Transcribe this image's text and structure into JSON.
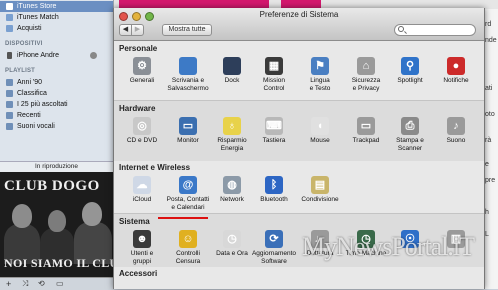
{
  "itunes": {
    "sidebar": {
      "store_items": [
        {
          "label": "iTunes Store",
          "icon": "store-icon",
          "color": "#5b7fb5",
          "selected": true
        },
        {
          "label": "iTunes Match",
          "icon": "cloud-icon",
          "color": "#7aa0d0"
        },
        {
          "label": "Acquisti",
          "icon": "download-icon",
          "color": "#7aa0d0"
        }
      ],
      "devices_heading": "DISPOSITIVI",
      "device_items": [
        {
          "label": "iPhone Andre",
          "icon": "iphone-icon",
          "color": "#555555"
        }
      ],
      "playlist_heading": "PLAYLIST",
      "playlist_items": [
        {
          "label": "Anni '90",
          "icon": "gear-playlist-icon",
          "color": "#6f8fb8"
        },
        {
          "label": "Classifica",
          "icon": "gear-playlist-icon",
          "color": "#6f8fb8"
        },
        {
          "label": "I 25 più ascoltati",
          "icon": "gear-playlist-icon",
          "color": "#6f8fb8"
        },
        {
          "label": "Recenti",
          "icon": "gear-playlist-icon",
          "color": "#6f8fb8"
        },
        {
          "label": "Suoni vocali",
          "icon": "gear-playlist-icon",
          "color": "#6f8fb8"
        }
      ]
    },
    "now_playing_label": "In riproduzione",
    "album": {
      "line1": "CLUB DOGO",
      "line2": "NOI SIAMO IL CLUB"
    }
  },
  "prefs": {
    "window_title": "Preferenze di Sistema",
    "back_label": "◀",
    "forward_label": "▶",
    "show_all_label": "Mostra tutte",
    "search_placeholder": "",
    "sections": [
      {
        "title": "Personale",
        "items": [
          {
            "label": "Generali",
            "icon": "general-icon",
            "color": "#8a8f96",
            "glyph": "⚙"
          },
          {
            "label": "Scrivania e\nSalvaschermo",
            "icon": "desktop-icon",
            "color": "#3d7ac6",
            "glyph": ""
          },
          {
            "label": "Dock",
            "icon": "dock-icon",
            "color": "#2d3e5a",
            "glyph": ""
          },
          {
            "label": "Mission\nControl",
            "icon": "mission-control-icon",
            "color": "#3a3a3a",
            "glyph": "▦"
          },
          {
            "label": "Lingua\ne Testo",
            "icon": "flag-icon",
            "color": "#4a7fc2",
            "glyph": "⚑"
          },
          {
            "label": "Sicurezza\ne Privacy",
            "icon": "house-icon",
            "color": "#9a9a9a",
            "glyph": "⌂"
          },
          {
            "label": "Spotlight",
            "icon": "spotlight-icon",
            "color": "#2f73c9",
            "glyph": "⚲"
          },
          {
            "label": "Notifiche",
            "icon": "notifications-icon",
            "color": "#cc2a2a",
            "glyph": "●"
          }
        ]
      },
      {
        "title": "Hardware",
        "items": [
          {
            "label": "CD e DVD",
            "icon": "cd-icon",
            "color": "#c8c8c8",
            "glyph": "◎"
          },
          {
            "label": "Monitor",
            "icon": "monitor-icon",
            "color": "#3b6fb0",
            "glyph": "▭"
          },
          {
            "label": "Risparmio\nEnergia",
            "icon": "bulb-icon",
            "color": "#e8d24a",
            "glyph": "♁"
          },
          {
            "label": "Tastiera",
            "icon": "keyboard-icon",
            "color": "#b8b8b8",
            "glyph": "⌨"
          },
          {
            "label": "Mouse",
            "icon": "mouse-icon",
            "color": "#e0e0e0",
            "glyph": "◖"
          },
          {
            "label": "Trackpad",
            "icon": "trackpad-icon",
            "color": "#9a9a9a",
            "glyph": "▭"
          },
          {
            "label": "Stampa e\nScanner",
            "icon": "printer-icon",
            "color": "#8a8a8a",
            "glyph": "⎙"
          },
          {
            "label": "Suono",
            "icon": "speaker-icon",
            "color": "#9a9a9a",
            "glyph": "♪"
          }
        ]
      },
      {
        "title": "Internet e Wireless",
        "items": [
          {
            "label": "iCloud",
            "icon": "icloud-icon",
            "color": "#cfd8e6",
            "glyph": "☁"
          },
          {
            "label": "Posta, Contatti\ne Calendari",
            "icon": "at-icon",
            "color": "#3a78c8",
            "glyph": "@"
          },
          {
            "label": "Network",
            "icon": "network-globe-icon",
            "color": "#8c9aa8",
            "glyph": "◍"
          },
          {
            "label": "Bluetooth",
            "icon": "bluetooth-icon",
            "color": "#2d66c4",
            "glyph": "ᛒ"
          },
          {
            "label": "Condivisione",
            "icon": "sharing-folder-icon",
            "color": "#c9b56a",
            "glyph": "▤"
          }
        ]
      },
      {
        "title": "Sistema",
        "items": [
          {
            "label": "Utenti e\ngruppi",
            "icon": "users-icon",
            "color": "#3a3a3a",
            "glyph": "☻"
          },
          {
            "label": "Controlli\nCensura",
            "icon": "parental-controls-icon",
            "color": "#e0b020",
            "glyph": "☺"
          },
          {
            "label": "Data e Ora",
            "icon": "clock-icon",
            "color": "#d8d8d8",
            "glyph": "◷"
          },
          {
            "label": "Aggiornamento\nSoftware",
            "icon": "software-update-icon",
            "color": "#3a6fb8",
            "glyph": "⟳"
          },
          {
            "label": "Dettatura",
            "icon": "microphone-icon",
            "color": "#9a9a9a",
            "glyph": "♩"
          },
          {
            "label": "Time Machine",
            "icon": "time-machine-icon",
            "color": "#3a6a4a",
            "glyph": "◷"
          },
          {
            "label": "",
            "icon": "accessibility-icon",
            "color": "#2f6fc8",
            "glyph": "☉"
          },
          {
            "label": "",
            "icon": "startup-disk-icon",
            "color": "#9a9a9a",
            "glyph": "▥"
          }
        ]
      },
      {
        "title": "Accessori",
        "items": []
      }
    ]
  },
  "watermark": {
    "text": "MyNewsPortal.iT"
  },
  "right_peek": [
    "rd",
    "nde",
    "",
    "ati",
    "",
    "oto",
    "",
    "rà",
    "",
    "e",
    "pre",
    "",
    "h",
    "L"
  ],
  "colors": {
    "highlight_underline": "#dd1111",
    "selected_sidebar": "#6b8fc2"
  }
}
